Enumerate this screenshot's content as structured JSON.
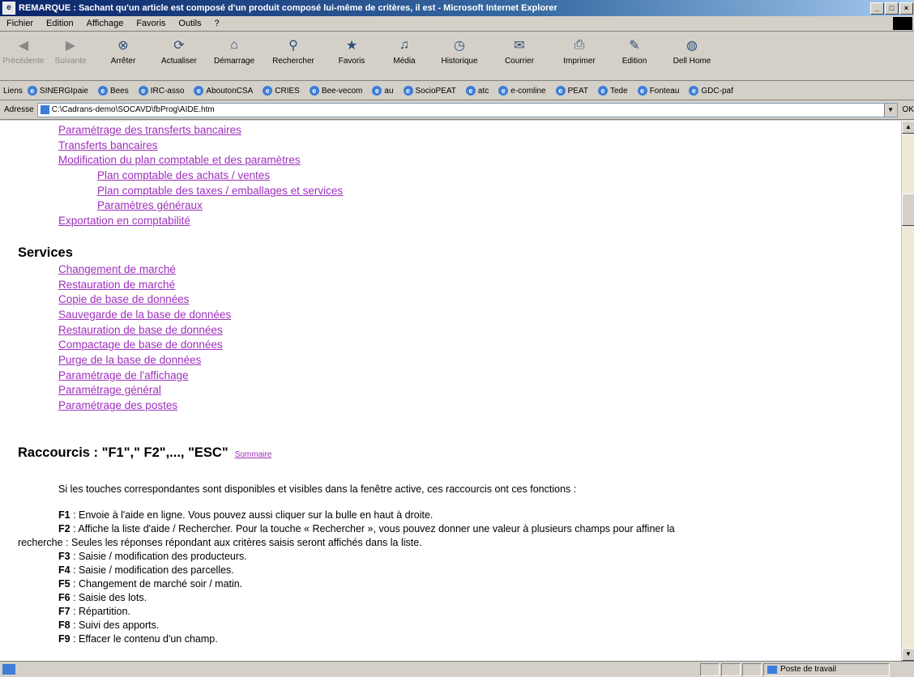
{
  "window": {
    "title": "REMARQUE : Sachant qu'un article est composé d'un produit composé lui-même de critères, il est - Microsoft Internet Explorer",
    "app_icon": "ie-icon"
  },
  "menu": [
    "Fichier",
    "Edition",
    "Affichage",
    "Favoris",
    "Outils",
    "?"
  ],
  "toolbar": [
    {
      "label": "Précédente",
      "icon": "back-arrow",
      "disabled": true
    },
    {
      "label": "Suivante",
      "icon": "forward-arrow",
      "disabled": true
    },
    {
      "label": "Arrêter",
      "icon": "stop"
    },
    {
      "label": "Actualiser",
      "icon": "refresh"
    },
    {
      "label": "Démarrage",
      "icon": "home"
    },
    {
      "label": "Rechercher",
      "icon": "search"
    },
    {
      "label": "Favoris",
      "icon": "favorites"
    },
    {
      "label": "Média",
      "icon": "media"
    },
    {
      "label": "Historique",
      "icon": "history"
    },
    {
      "label": "Courrier",
      "icon": "mail"
    },
    {
      "label": "Imprimer",
      "icon": "print"
    },
    {
      "label": "Edition",
      "icon": "edit"
    },
    {
      "label": "Dell Home",
      "icon": "dell"
    }
  ],
  "links_bar": {
    "label": "Liens",
    "items": [
      "SINERGIpaie",
      "Bees",
      "IRC-asso",
      "AboutonCSA",
      "CRIES",
      "Bee-vecom",
      "au",
      "SocioPEAT",
      "atc",
      "e-comline",
      "PEAT",
      "Tede",
      "Fonteau",
      "GDC-paf"
    ]
  },
  "address": {
    "label": "Adresse",
    "value": "C:\\Cadrans-demo\\SOCAVD\\fbProg\\AIDE.htm",
    "go_label": "OK"
  },
  "content": {
    "links_top": [
      {
        "text": "Paramétrage des transferts bancaires",
        "level": 1
      },
      {
        "text": "Transferts bancaires",
        "level": 1
      },
      {
        "text": "Modification du plan comptable et des paramètres",
        "level": 1
      },
      {
        "text": "Plan comptable des achats / ventes",
        "level": 2
      },
      {
        "text": "Plan comptable des taxes / emballages et services",
        "level": 2
      },
      {
        "text": "Paramètres généraux",
        "level": 2
      },
      {
        "text": "Exportation en comptabilité",
        "level": 1
      }
    ],
    "services_heading": "Services",
    "services_links": [
      "Changement de marché",
      "Restauration de marché",
      "Copie de base de données",
      "Sauvegarde de la base de données",
      "Restauration de base de données",
      "Compactage de base de données",
      "Purge de la base de données",
      "Paramétrage de l'affichage",
      "Paramétrage général",
      "Paramétrage des postes"
    ],
    "raccourcis_heading": "Raccourcis : \"F1\",\" F2\",..., \"ESC\"",
    "sommaire_link": "Sommaire",
    "intro": "Si les touches correspondantes sont disponibles et visibles dans la fenêtre active, ces raccourcis ont ces fonctions :",
    "shortcuts": [
      {
        "key": "F1",
        "text": " : Envoie à l'aide en ligne. Vous pouvez aussi cliquer sur la bulle en haut à droite."
      },
      {
        "key": "F2",
        "text": " : Affiche la liste d'aide / Rechercher. Pour la touche « Rechercher », vous pouvez donner une valeur à plusieurs champs pour affiner la"
      },
      {
        "key": "",
        "text": "recherche : Seules les réponses répondant aux critères saisis seront affichés dans la liste."
      },
      {
        "key": "F3",
        "text": " : Saisie / modification des producteurs."
      },
      {
        "key": "F4",
        "text": " : Saisie / modification des parcelles."
      },
      {
        "key": "F5",
        "text": " : Changement de marché soir / matin."
      },
      {
        "key": "F6",
        "text": " : Saisie des lots."
      },
      {
        "key": "F7",
        "text": " : Répartition."
      },
      {
        "key": "F8",
        "text": " : Suivi des apports."
      },
      {
        "key": "F9",
        "text": " : Effacer le contenu d'un champ."
      }
    ]
  },
  "status": {
    "zone_label": "Poste de travail"
  }
}
